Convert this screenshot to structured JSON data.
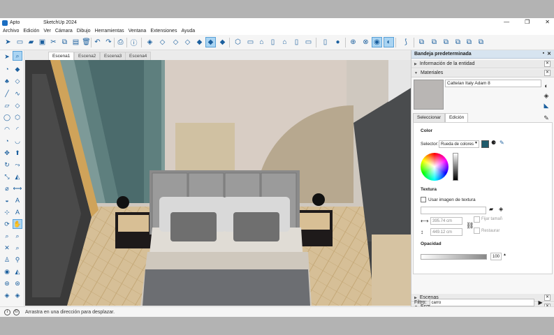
{
  "window": {
    "doc_name": "Apto",
    "app_title": "SketchUp 2024",
    "controls": [
      "—",
      "❐",
      "✕"
    ]
  },
  "menu": [
    "Archivo",
    "Edición",
    "Ver",
    "Cámara",
    "Dibujo",
    "Herramientas",
    "Ventana",
    "Extensiones",
    "Ayuda"
  ],
  "scenes": [
    "Escena1",
    "Escena2",
    "Escena3",
    "Escena4"
  ],
  "status": {
    "message": "Arrastra en una dirección para desplazar."
  },
  "tray": {
    "title": "Bandeja predeterminada",
    "entity_info": "Información de la entidad",
    "materials": "Materiales",
    "material_name": "Cattelan Italy Adam 8",
    "tab_select": "Seleccionar",
    "tab_edit": "Edición",
    "color_heading": "Color",
    "selector_label": "Selector:",
    "selector_value": "Rueda de colores",
    "texture_heading": "Textura",
    "use_texture_label": "Usar imagen de textura",
    "width_value": "395.74 cm",
    "height_value": "449.12 cm",
    "fix_size": "Fijar tamañ",
    "restore": "Restaurar",
    "opacity_heading": "Opacidad",
    "opacity_value": "100",
    "scenes_section": "Escenas",
    "outliner_section": "Esquema",
    "filter_label": "Filtro:",
    "filter_value": "carro"
  },
  "colors": {
    "accent": "#1b5f9e",
    "tray_header": "#d7e4f0",
    "material_color": "#1f5a6b"
  }
}
